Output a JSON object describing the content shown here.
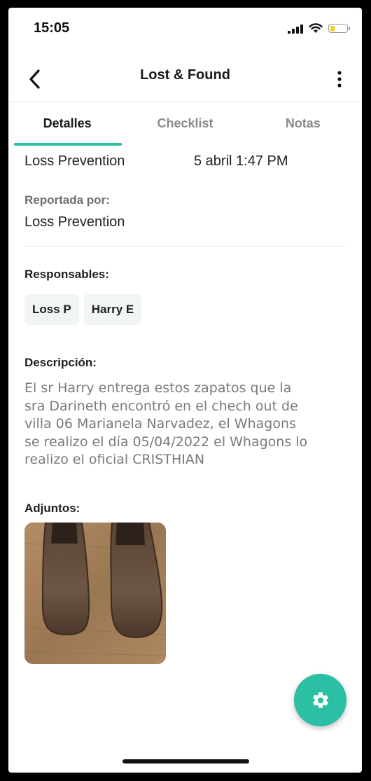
{
  "status_bar": {
    "time": "15:05",
    "battery_level": 0.3
  },
  "header": {
    "title": "Lost & Found",
    "back_icon": "chevron-left-icon",
    "menu_icon": "more-vertical-icon"
  },
  "tabs": [
    {
      "label": "Detalles",
      "active": true
    },
    {
      "label": "Checklist",
      "active": false
    },
    {
      "label": "Notas",
      "active": false
    }
  ],
  "details": {
    "department": "Loss Prevention",
    "date": "5 abril 1:47 PM",
    "reported_by_label": "Reportada por:",
    "reported_by": "Loss Prevention",
    "responsables_label": "Responsables:",
    "responsables": [
      "Loss P",
      "Harry E"
    ],
    "description_label": "Descripción:",
    "description": "El sr Harry entrega estos zapatos que la sra Darineth encontró en el chech out de villa 06 Marianela Narvadez, el Whagons se realizo el día 05/04/2022 el Whagons lo realizo el oficial CRISTHIAN",
    "attachments_label": "Adjuntos:"
  },
  "colors": {
    "accent": "#2bbfa3",
    "chip_bg": "#f1f5f3"
  },
  "fab": {
    "icon": "gear-icon"
  }
}
